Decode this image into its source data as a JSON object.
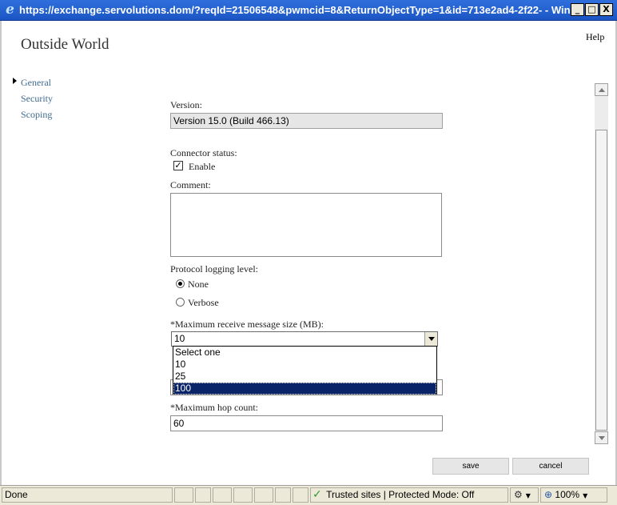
{
  "window": {
    "title": "https://exchange.servolutions.dom/?reqId=21506548&pwmcid=8&ReturnObjectType=1&id=713e2ad4-2f22- - Window...",
    "minimize_glyph": "_",
    "maximize_glyph": "□",
    "close_glyph": "X"
  },
  "page": {
    "title": "Outside World",
    "help": "Help"
  },
  "nav": {
    "items": [
      {
        "label": "General"
      },
      {
        "label": "Security"
      },
      {
        "label": "Scoping"
      }
    ]
  },
  "form": {
    "version_label": "Version:",
    "version_value": "Version 15.0 (Build 466.13)",
    "connector_status_label": "Connector status:",
    "enable_label": "Enable",
    "enable_checked": true,
    "comment_label": "Comment:",
    "comment_value": "",
    "protocol_logging_label": "Protocol logging level:",
    "logging_options": [
      {
        "label": "None",
        "selected": true
      },
      {
        "label": "Verbose",
        "selected": false
      }
    ],
    "max_message_size_label": "*Maximum receive message size (MB):",
    "max_message_size_value": "10",
    "max_message_size_options": [
      "Select one",
      "10",
      "25",
      "100"
    ],
    "max_message_size_highlighted": "100",
    "max_hop_label": "*Maximum hop count:",
    "max_hop_value": "60"
  },
  "buttons": {
    "save": "save",
    "cancel": "cancel"
  },
  "statusbar": {
    "status": "Done",
    "zone": "Trusted sites | Protected Mode: Off",
    "zoom": "100%"
  },
  "colors": {
    "titlebar": "#1b55c4",
    "nav_link": "#3f6b8f",
    "selection": "#0a246a"
  }
}
